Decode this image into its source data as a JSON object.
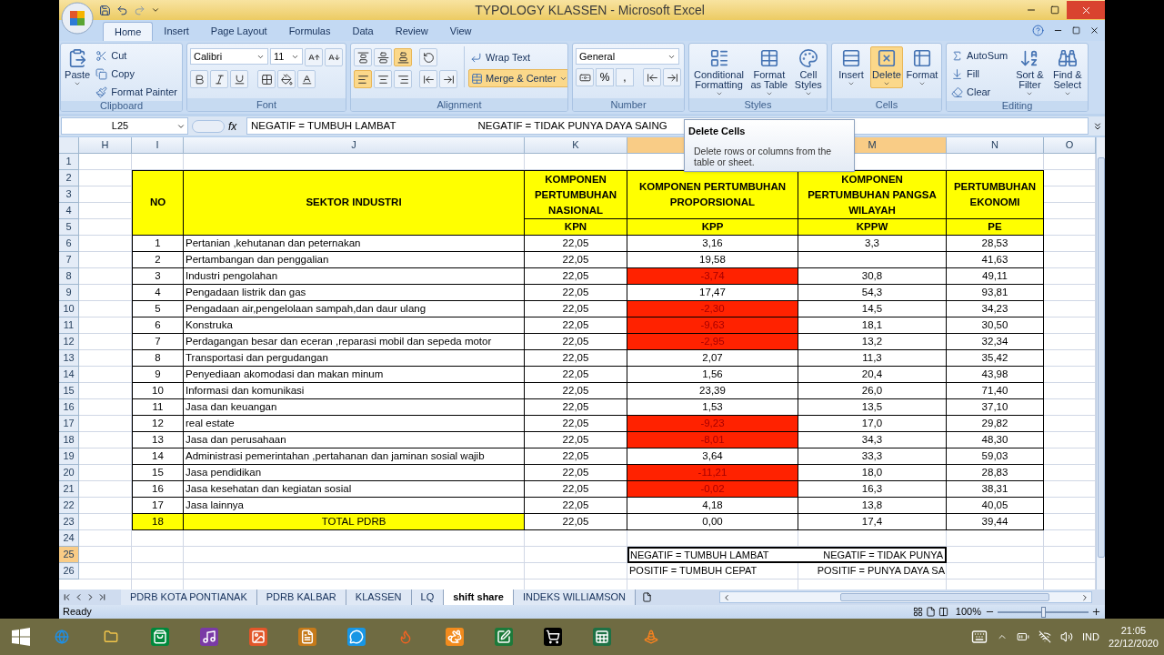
{
  "window": {
    "title": "TYPOLOGY KLASSEN - Microsoft Excel"
  },
  "ribbon_tabs": [
    {
      "label": "Home",
      "selected": true
    },
    {
      "label": "Insert",
      "selected": false
    },
    {
      "label": "Page Layout",
      "selected": false
    },
    {
      "label": "Formulas",
      "selected": false
    },
    {
      "label": "Data",
      "selected": false
    },
    {
      "label": "Review",
      "selected": false
    },
    {
      "label": "View",
      "selected": false
    }
  ],
  "ribbon": {
    "clipboard": {
      "label": "Clipboard",
      "paste": "Paste",
      "items": [
        "Cut",
        "Copy",
        "Format Painter"
      ]
    },
    "font": {
      "label": "Font",
      "family": "Calibri",
      "size": "11"
    },
    "alignment": {
      "label": "Alignment",
      "vertical_align": [
        {
          "selected": false
        },
        {
          "selected": false
        },
        {
          "selected": true
        }
      ],
      "horizontal_align": [
        {
          "selected": true
        },
        {
          "selected": false
        },
        {
          "selected": false
        }
      ],
      "wrap": "Wrap Text",
      "merge": {
        "label": "Merge & Center",
        "selected": true
      }
    },
    "number": {
      "label": "Number",
      "format": "General",
      "symbols": [
        "%",
        ","
      ]
    },
    "styles": {
      "label": "Styles",
      "buttons": [
        "Conditional Formatting",
        "Format as Table",
        "Cell Styles"
      ]
    },
    "cells": {
      "label": "Cells",
      "buttons": [
        {
          "label": "Insert",
          "selected": false
        },
        {
          "label": "Delete",
          "selected": true
        },
        {
          "label": "Format",
          "selected": false
        }
      ]
    },
    "editing": {
      "label": "Editing",
      "items": [
        "AutoSum",
        "Fill",
        "Clear"
      ],
      "buttons": [
        "Sort & Filter",
        "Find & Select"
      ]
    }
  },
  "formula_bar": {
    "name_box": "L25",
    "function_label": "fx",
    "formula_parts": [
      "NEGATIF = TUMBUH LAMBAT",
      "NEGATIF = TIDAK PUNYA DAYA SAING"
    ]
  },
  "tooltip": {
    "title": "Delete Cells",
    "text": "Delete rows or columns from the table or sheet."
  },
  "column_headers": [
    {
      "label": "H",
      "selected": false
    },
    {
      "label": "I",
      "selected": false
    },
    {
      "label": "J",
      "selected": false
    },
    {
      "label": "K",
      "selected": false
    },
    {
      "selected": true
    },
    {
      "label": "M",
      "selected": true
    },
    {
      "label": "N",
      "selected": false
    },
    {
      "label": "O",
      "selected": false
    }
  ],
  "row_headers": [
    {
      "label": "1",
      "selected": false
    },
    {
      "label": "2",
      "selected": false
    },
    {
      "label": "3",
      "selected": false
    },
    {
      "label": "4",
      "selected": false
    },
    {
      "label": "5",
      "selected": false
    },
    {
      "label": "6",
      "selected": false
    },
    {
      "label": "7",
      "selected": false
    },
    {
      "label": "8",
      "selected": false
    },
    {
      "label": "9",
      "selected": false
    },
    {
      "label": "10",
      "selected": false
    },
    {
      "label": "11",
      "selected": false
    },
    {
      "label": "12",
      "selected": false
    },
    {
      "label": "13",
      "selected": false
    },
    {
      "label": "14",
      "selected": false
    },
    {
      "label": "15",
      "selected": false
    },
    {
      "label": "16",
      "selected": false
    },
    {
      "label": "17",
      "selected": false
    },
    {
      "label": "18",
      "selected": false
    },
    {
      "label": "19",
      "selected": false
    },
    {
      "label": "20",
      "selected": false
    },
    {
      "label": "21",
      "selected": false
    },
    {
      "label": "22",
      "selected": false
    },
    {
      "label": "23",
      "selected": false
    },
    {
      "label": "24",
      "selected": false
    },
    {
      "label": "25",
      "selected": true
    },
    {
      "label": "26",
      "selected": false
    }
  ],
  "table": {
    "headings": [
      "NO",
      "SEKTOR INDUSTRI"
    ],
    "columns": [
      {
        "heading": "KOMPONEN PERTUMBUHAN NASIONAL",
        "code": "KPN"
      },
      {
        "heading": "KOMPONEN PERTUMBUHAN PROPORSIONAL",
        "code": "KPP"
      },
      {
        "heading": "KOMPONEN PERTUMBUHAN PANGSA WILAYAH",
        "code": "KPPW"
      },
      {
        "heading": "PERTUMBUHAN EKONOMI",
        "code": "PE"
      }
    ],
    "rows": [
      {
        "no": "1",
        "sector": "Pertanian ,kehutanan dan peternakan",
        "kpn": "22,05",
        "kpp": "3,16",
        "kppw": "3,3",
        "pe": "28,53",
        "negative": false
      },
      {
        "no": "2",
        "sector": "Pertambangan dan penggalian",
        "kpn": "22,05",
        "kpp": "19,58",
        "pe": "41,63",
        "negative": false
      },
      {
        "no": "3",
        "sector": "Industri pengolahan",
        "kpn": "22,05",
        "kpp": "-3,74",
        "kppw": "30,8",
        "pe": "49,11",
        "negative": true
      },
      {
        "no": "4",
        "sector": "Pengadaan listrik dan gas",
        "kpn": "22,05",
        "kpp": "17,47",
        "kppw": "54,3",
        "pe": "93,81",
        "negative": false
      },
      {
        "no": "5",
        "sector": "Pengadaan air,pengelolaan sampah,dan daur ulang",
        "kpn": "22,05",
        "kpp": "-2,30",
        "kppw": "14,5",
        "pe": "34,23",
        "negative": true
      },
      {
        "no": "6",
        "sector": "Konstruka",
        "kpn": "22,05",
        "kpp": "-9,63",
        "kppw": "18,1",
        "pe": "30,50",
        "negative": true
      },
      {
        "no": "7",
        "sector": "Perdagangan besar dan eceran ,reparasi mobil dan sepeda motor",
        "kpn": "22,05",
        "kpp": "-2,95",
        "kppw": "13,2",
        "pe": "32,34",
        "negative": true
      },
      {
        "no": "8",
        "sector": "Transportasi dan pergudangan",
        "kpn": "22,05",
        "kpp": "2,07",
        "kppw": "11,3",
        "pe": "35,42",
        "negative": false
      },
      {
        "no": "9",
        "sector": "Penyediaan akomodasi dan makan minum",
        "kpn": "22,05",
        "kpp": "1,56",
        "kppw": "20,4",
        "pe": "43,98",
        "negative": false
      },
      {
        "no": "10",
        "sector": "Informasi dan komunikasi",
        "kpn": "22,05",
        "kpp": "23,39",
        "kppw": "26,0",
        "pe": "71,40",
        "negative": false
      },
      {
        "no": "11",
        "sector": "Jasa dan keuangan",
        "kpn": "22,05",
        "kpp": "1,53",
        "kppw": "13,5",
        "pe": "37,10",
        "negative": false
      },
      {
        "no": "12",
        "sector": "real estate",
        "kpn": "22,05",
        "kpp": "-9,23",
        "kppw": "17,0",
        "pe": "29,82",
        "negative": true
      },
      {
        "no": "13",
        "sector": "Jasa dan perusahaan",
        "kpn": "22,05",
        "kpp": "-8,01",
        "kppw": "34,3",
        "pe": "48,30",
        "negative": true
      },
      {
        "no": "14",
        "sector": "Administrasi pemerintahan ,pertahanan dan jaminan sosial wajib",
        "kpn": "22,05",
        "kpp": "3,64",
        "kppw": "33,3",
        "pe": "59,03",
        "negative": false
      },
      {
        "no": "15",
        "sector": "Jasa pendidikan",
        "kpn": "22,05",
        "kpp": "-11,21",
        "kppw": "18,0",
        "pe": "28,83",
        "negative": true
      },
      {
        "no": "16",
        "sector": "Jasa kesehatan dan kegiatan sosial",
        "kpn": "22,05",
        "kpp": "-0,02",
        "kppw": "16,3",
        "pe": "38,31",
        "negative": true
      },
      {
        "no": "17",
        "sector": "Jasa lainnya",
        "kpn": "22,05",
        "kpp": "4,18",
        "kppw": "13,8",
        "pe": "40,05",
        "negative": false
      }
    ],
    "total": {
      "no": "18",
      "sector": "TOTAL PDRB",
      "kpn": "22,05",
      "kpp": "0,00",
      "kppw": "17,4",
      "pe": "39,44"
    }
  },
  "notes": [
    [
      "NEGATIF = TUMBUH LAMBAT",
      "NEGATIF = TIDAK PUNYA"
    ],
    [
      "POSITIF  = TUMBUH CEPAT",
      "POSITIF  = PUNYA DAYA SA"
    ]
  ],
  "sheet_tabs": [
    {
      "label": "PDRB KOTA PONTIANAK",
      "selected": false
    },
    {
      "label": "PDRB KALBAR",
      "selected": false
    },
    {
      "label": "KLASSEN",
      "selected": false
    },
    {
      "label": "LQ",
      "selected": false
    },
    {
      "label": "shift share",
      "selected": true
    },
    {
      "label": "INDEKS WILLIAMSON",
      "selected": false
    }
  ],
  "status_bar": {
    "text": "Ready",
    "zoom": {
      "reading": "100%",
      "level": 0.5
    }
  },
  "taskbar": {
    "language": "IND",
    "time": "21:05",
    "date": "22/12/2020"
  }
}
